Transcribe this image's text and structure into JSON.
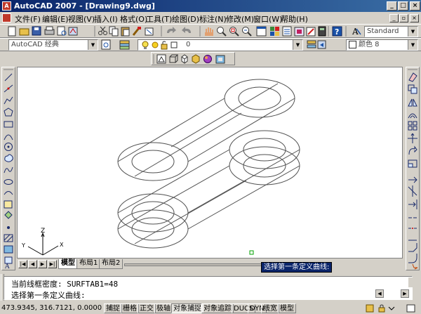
{
  "titlebar": {
    "app_icon_text": "A",
    "title": "AutoCAD 2007 - [Drawing9.dwg]",
    "min_glyph": "_",
    "max_glyph": "□",
    "close_glyph": "×"
  },
  "menubar": {
    "items": [
      "文件(F)",
      "编辑(E)",
      "视图(V)",
      "插入(I)",
      "格式(O)",
      "工具(T)",
      "绘图(D)",
      "标注(N)",
      "修改(M)",
      "窗口(W)",
      "帮助(H)"
    ],
    "doc_min": "_",
    "doc_restore": "▫",
    "doc_close": "×"
  },
  "toolbar_standard": {
    "icons": [
      "new-icon",
      "open-icon",
      "save-icon",
      "print-icon",
      "plot-preview-icon",
      "publish-icon",
      "cut-icon",
      "copy-icon",
      "paste-icon",
      "match-properties-icon",
      "block-editor-icon",
      "undo-icon",
      "redo-icon",
      "pan-icon",
      "zoom-realtime-icon",
      "zoom-window-icon",
      "zoom-previous-icon",
      "properties-icon",
      "design-center-icon",
      "tool-palettes-icon",
      "sheet-set-icon",
      "markup-icon",
      "calculator-icon",
      "help-icon"
    ],
    "text_style_label": "Standard"
  },
  "toolbar_layers": {
    "workspace": "AutoCAD 经典",
    "layer": "0",
    "color": "颜色 8"
  },
  "toolbar_render": {
    "icons": [
      "hide-icon",
      "3d-wireframe-icon",
      "hidden-icon",
      "realistic-icon",
      "conceptual-icon",
      "render-icon"
    ]
  },
  "draw_toolbar": {
    "icons": [
      "line-icon",
      "construction-line-icon",
      "polyline-icon",
      "polygon-icon",
      "rectangle-icon",
      "arc-icon",
      "circle-icon",
      "revision-cloud-icon",
      "spline-icon",
      "ellipse-icon",
      "ellipse-arc-icon",
      "insert-block-icon",
      "make-block-icon",
      "point-icon",
      "hatch-icon",
      "gradient-icon",
      "region-icon",
      "table-icon",
      "multiline-text-icon"
    ]
  },
  "modify_toolbar": {
    "icons": [
      "erase-icon",
      "copy-object-icon",
      "mirror-icon",
      "offset-icon",
      "array-icon",
      "move-icon",
      "rotate-icon",
      "scale-icon",
      "stretch-icon",
      "trim-icon",
      "extend-icon",
      "break-at-point-icon",
      "break-icon",
      "join-icon",
      "chamfer-icon",
      "fillet-icon",
      "explode-icon"
    ]
  },
  "ucs": {
    "x": "X",
    "y": "Y",
    "z": "Z"
  },
  "tabs": {
    "nav": [
      "|◀",
      "◀",
      "▶",
      "▶|"
    ],
    "items": [
      "模型",
      "布局1",
      "布局2"
    ],
    "active": 0
  },
  "tooltip": "选择第一条定义曲线:",
  "command": {
    "history": "当前线框密度:  SURFTAB1=48",
    "prompt": "选择第一条定义曲线:"
  },
  "statusbar": {
    "coords": "473.9345, 316.7121, 0.0000",
    "toggles": [
      {
        "label": "捕捉",
        "on": false
      },
      {
        "label": "栅格",
        "on": false
      },
      {
        "label": "正交",
        "on": false
      },
      {
        "label": "极轴",
        "on": false
      },
      {
        "label": "对象捕捉",
        "on": true
      },
      {
        "label": "对象追踪",
        "on": false
      },
      {
        "label": "DUCS",
        "on": false
      },
      {
        "label": "DYN",
        "on": false
      },
      {
        "label": "线宽",
        "on": false
      },
      {
        "label": "模型",
        "on": false
      }
    ]
  },
  "colors": {
    "title_start": "#0a246a",
    "title_end": "#3a6ea5",
    "chrome": "#d4d0c8",
    "canvas": "#ffffff",
    "wire": "#505050",
    "grip": "#00a000"
  }
}
